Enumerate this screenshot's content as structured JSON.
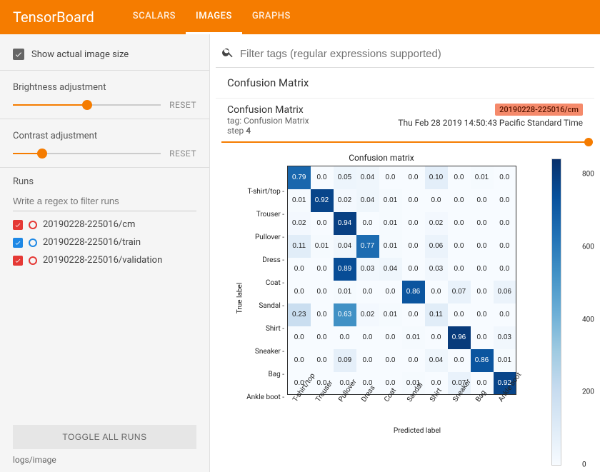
{
  "header": {
    "logo": "TensorBoard",
    "tabs": [
      "SCALARS",
      "IMAGES",
      "GRAPHS"
    ],
    "active_tab": 1
  },
  "sidebar": {
    "show_actual_label": "Show actual image size",
    "brightness_label": "Brightness adjustment",
    "contrast_label": "Contrast adjustment",
    "reset_label": "RESET",
    "brightness_value": 0.5,
    "contrast_value": 0.2,
    "runs_label": "Runs",
    "runs_filter_placeholder": "Write a regex to filter runs",
    "runs": [
      {
        "name": "20190228-225016/cm",
        "color": "#E53935",
        "checked": true
      },
      {
        "name": "20190228-225016/train",
        "color": "#1E88E5",
        "checked": true
      },
      {
        "name": "20190228-225016/validation",
        "color": "#E53935",
        "checked": true
      }
    ],
    "toggle_all_label": "TOGGLE ALL RUNS",
    "logdir": "logs/image"
  },
  "main": {
    "search_placeholder": "Filter tags (regular expressions supported)",
    "panel_title": "Confusion Matrix",
    "card_title": "Confusion Matrix",
    "card_tag": "tag: Confusion Matrix",
    "step_label": "step",
    "step_value": "4",
    "run_badge": "20190228-225016/cm",
    "timestamp": "Thu Feb 28 2019 14:50:43 Pacific Standard Time"
  },
  "chart_data": {
    "type": "heatmap",
    "title": "Confusion matrix",
    "xlabel": "Predicted label",
    "ylabel": "True label",
    "categories": [
      "T-shirt/top",
      "Trouser",
      "Pullover",
      "Dress",
      "Coat",
      "Sandal",
      "Shirt",
      "Sneaker",
      "Bag",
      "Ankle boot"
    ],
    "values": [
      [
        0.79,
        0.0,
        0.05,
        0.04,
        0.0,
        0.0,
        0.1,
        0.0,
        0.01,
        0.0
      ],
      [
        0.01,
        0.92,
        0.02,
        0.04,
        0.01,
        0.0,
        0.0,
        0.0,
        0.0,
        0.0
      ],
      [
        0.02,
        0.0,
        0.94,
        0.0,
        0.01,
        0.0,
        0.02,
        0.0,
        0.0,
        0.0
      ],
      [
        0.11,
        0.01,
        0.04,
        0.77,
        0.01,
        0.0,
        0.06,
        0.0,
        0.0,
        0.0
      ],
      [
        0.0,
        0.0,
        0.89,
        0.03,
        0.04,
        0.0,
        0.03,
        0.0,
        0.0,
        0.0
      ],
      [
        0.0,
        0.0,
        0.01,
        0.0,
        0.0,
        0.86,
        0.0,
        0.07,
        0.0,
        0.06
      ],
      [
        0.23,
        0.0,
        0.63,
        0.02,
        0.01,
        0.0,
        0.11,
        0.0,
        0.0,
        0.0
      ],
      [
        0.0,
        0.0,
        0.0,
        0.0,
        0.0,
        0.01,
        0.0,
        0.96,
        0.0,
        0.03
      ],
      [
        0.0,
        0.0,
        0.09,
        0.0,
        0.0,
        0.0,
        0.04,
        0.0,
        0.86,
        0.01
      ],
      [
        0.0,
        0.0,
        0.0,
        0.0,
        0.0,
        0.01,
        0.0,
        0.07,
        0.0,
        0.92
      ]
    ],
    "colorbar_ticks": [
      0,
      200,
      400,
      600,
      800
    ]
  }
}
